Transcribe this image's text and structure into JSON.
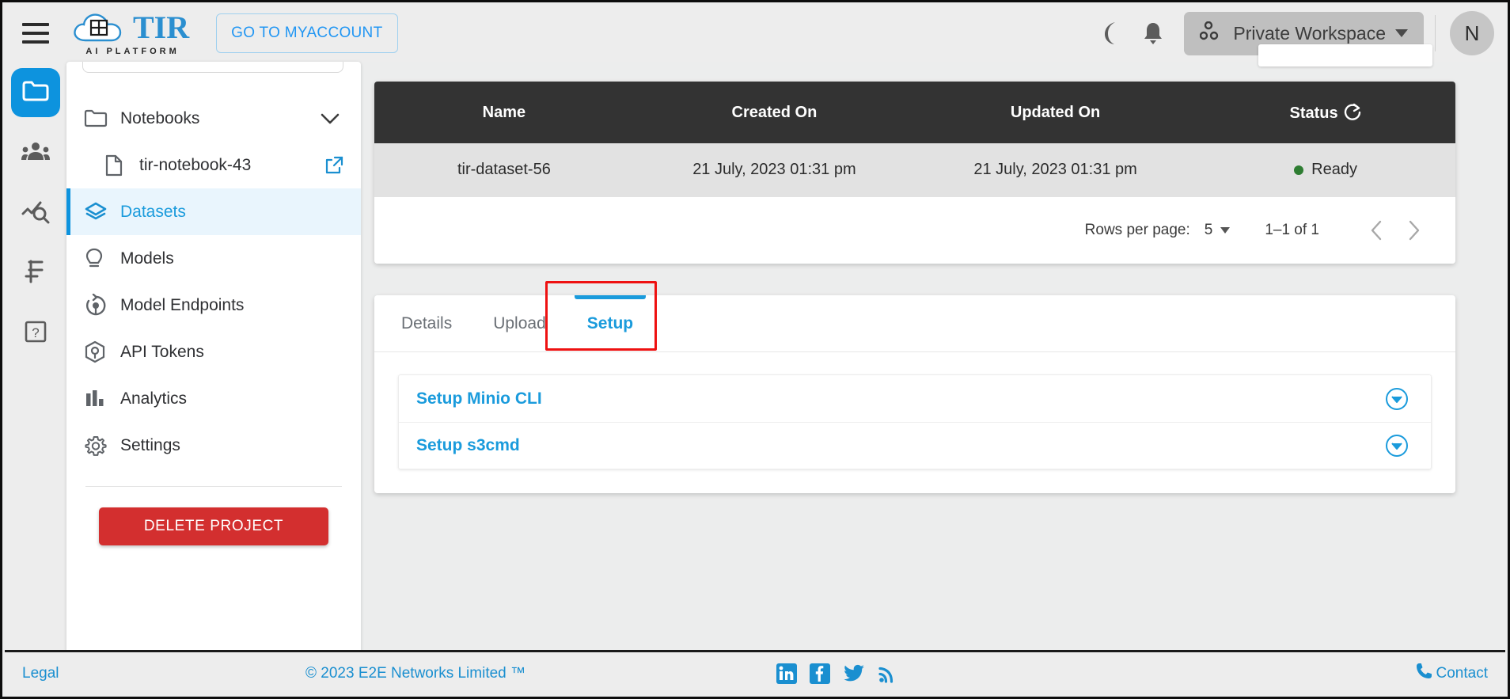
{
  "header": {
    "menu_icon": "hamburger-icon",
    "brand": {
      "title": "TIR",
      "subtitle": "AI PLATFORM"
    },
    "myaccount_button": "GO TO MYACCOUNT",
    "dark_mode_icon": "moon-icon",
    "notifications_icon": "bell-icon",
    "workspace": {
      "label": "Private Workspace",
      "icon": "workspace-icon"
    },
    "avatar_initial": "N"
  },
  "rail": {
    "items": [
      {
        "name": "projects",
        "icon": "folder-icon",
        "active": true
      },
      {
        "name": "team",
        "icon": "people-icon",
        "active": false
      },
      {
        "name": "monitoring",
        "icon": "analytics-search-icon",
        "active": false
      },
      {
        "name": "billing",
        "icon": "rupee-icon",
        "active": false
      },
      {
        "name": "help",
        "icon": "help-box-icon",
        "active": false
      }
    ]
  },
  "nav": {
    "items": [
      {
        "label": "Notebooks",
        "icon": "folder-icon",
        "type": "group",
        "expanded": true,
        "trailing": "chevron-down-icon"
      },
      {
        "label": "tir-notebook-43",
        "icon": "file-icon",
        "type": "child",
        "trailing": "external-link-icon"
      },
      {
        "label": "Datasets",
        "icon": "layers-icon",
        "type": "item",
        "active": true
      },
      {
        "label": "Models",
        "icon": "bulb-icon",
        "type": "item"
      },
      {
        "label": "Model Endpoints",
        "icon": "endpoint-icon",
        "type": "item"
      },
      {
        "label": "API Tokens",
        "icon": "cube-icon",
        "type": "item"
      },
      {
        "label": "Analytics",
        "icon": "bar-chart-icon",
        "type": "item"
      },
      {
        "label": "Settings",
        "icon": "gear-icon",
        "type": "item"
      }
    ],
    "delete_project_button": "DELETE PROJECT"
  },
  "table": {
    "columns": [
      "Name",
      "Created On",
      "Updated On",
      "Status"
    ],
    "refresh_icon": "refresh-icon",
    "rows": [
      {
        "name": "tir-dataset-56",
        "created_on": "21 July, 2023 01:31 pm",
        "updated_on": "21 July, 2023 01:31 pm",
        "status": "Ready",
        "status_color": "#2e7d32"
      }
    ],
    "pagination": {
      "rows_per_page_label": "Rows per page:",
      "rows_per_page_value": "5",
      "range": "1–1 of 1",
      "prev_icon": "chevron-left-icon",
      "next_icon": "chevron-right-icon"
    }
  },
  "tabs": {
    "items": [
      {
        "label": "Details",
        "active": false
      },
      {
        "label": "Upload",
        "active": false
      },
      {
        "label": "Setup",
        "active": true
      }
    ],
    "highlight_color": "#ee1111",
    "accent_color": "#1a9bdc"
  },
  "setup": {
    "accordions": [
      {
        "title": "Setup Minio CLI",
        "toggle_icon": "chevron-down-circle-icon"
      },
      {
        "title": "Setup s3cmd",
        "toggle_icon": "chevron-down-circle-icon"
      }
    ]
  },
  "footer": {
    "legal": "Legal",
    "copyright": "© 2023 E2E Networks Limited ™",
    "social": [
      "linkedin-icon",
      "facebook-icon",
      "twitter-icon",
      "rss-icon"
    ],
    "contact": "Contact",
    "contact_icon": "phone-icon"
  }
}
